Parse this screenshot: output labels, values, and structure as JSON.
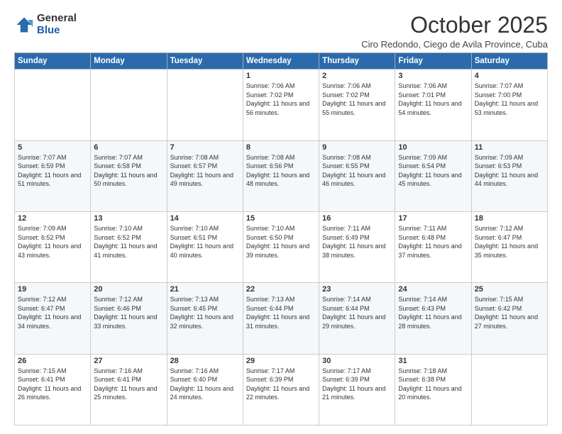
{
  "header": {
    "logo_general": "General",
    "logo_blue": "Blue",
    "month_title": "October 2025",
    "subtitle": "Ciro Redondo, Ciego de Avila Province, Cuba"
  },
  "days_of_week": [
    "Sunday",
    "Monday",
    "Tuesday",
    "Wednesday",
    "Thursday",
    "Friday",
    "Saturday"
  ],
  "weeks": [
    [
      {
        "day": "",
        "info": ""
      },
      {
        "day": "",
        "info": ""
      },
      {
        "day": "",
        "info": ""
      },
      {
        "day": "1",
        "info": "Sunrise: 7:06 AM\nSunset: 7:02 PM\nDaylight: 11 hours and 56 minutes."
      },
      {
        "day": "2",
        "info": "Sunrise: 7:06 AM\nSunset: 7:02 PM\nDaylight: 11 hours and 55 minutes."
      },
      {
        "day": "3",
        "info": "Sunrise: 7:06 AM\nSunset: 7:01 PM\nDaylight: 11 hours and 54 minutes."
      },
      {
        "day": "4",
        "info": "Sunrise: 7:07 AM\nSunset: 7:00 PM\nDaylight: 11 hours and 53 minutes."
      }
    ],
    [
      {
        "day": "5",
        "info": "Sunrise: 7:07 AM\nSunset: 6:59 PM\nDaylight: 11 hours and 51 minutes."
      },
      {
        "day": "6",
        "info": "Sunrise: 7:07 AM\nSunset: 6:58 PM\nDaylight: 11 hours and 50 minutes."
      },
      {
        "day": "7",
        "info": "Sunrise: 7:08 AM\nSunset: 6:57 PM\nDaylight: 11 hours and 49 minutes."
      },
      {
        "day": "8",
        "info": "Sunrise: 7:08 AM\nSunset: 6:56 PM\nDaylight: 11 hours and 48 minutes."
      },
      {
        "day": "9",
        "info": "Sunrise: 7:08 AM\nSunset: 6:55 PM\nDaylight: 11 hours and 46 minutes."
      },
      {
        "day": "10",
        "info": "Sunrise: 7:09 AM\nSunset: 6:54 PM\nDaylight: 11 hours and 45 minutes."
      },
      {
        "day": "11",
        "info": "Sunrise: 7:09 AM\nSunset: 6:53 PM\nDaylight: 11 hours and 44 minutes."
      }
    ],
    [
      {
        "day": "12",
        "info": "Sunrise: 7:09 AM\nSunset: 6:52 PM\nDaylight: 11 hours and 43 minutes."
      },
      {
        "day": "13",
        "info": "Sunrise: 7:10 AM\nSunset: 6:52 PM\nDaylight: 11 hours and 41 minutes."
      },
      {
        "day": "14",
        "info": "Sunrise: 7:10 AM\nSunset: 6:51 PM\nDaylight: 11 hours and 40 minutes."
      },
      {
        "day": "15",
        "info": "Sunrise: 7:10 AM\nSunset: 6:50 PM\nDaylight: 11 hours and 39 minutes."
      },
      {
        "day": "16",
        "info": "Sunrise: 7:11 AM\nSunset: 6:49 PM\nDaylight: 11 hours and 38 minutes."
      },
      {
        "day": "17",
        "info": "Sunrise: 7:11 AM\nSunset: 6:48 PM\nDaylight: 11 hours and 37 minutes."
      },
      {
        "day": "18",
        "info": "Sunrise: 7:12 AM\nSunset: 6:47 PM\nDaylight: 11 hours and 35 minutes."
      }
    ],
    [
      {
        "day": "19",
        "info": "Sunrise: 7:12 AM\nSunset: 6:47 PM\nDaylight: 11 hours and 34 minutes."
      },
      {
        "day": "20",
        "info": "Sunrise: 7:12 AM\nSunset: 6:46 PM\nDaylight: 11 hours and 33 minutes."
      },
      {
        "day": "21",
        "info": "Sunrise: 7:13 AM\nSunset: 6:45 PM\nDaylight: 11 hours and 32 minutes."
      },
      {
        "day": "22",
        "info": "Sunrise: 7:13 AM\nSunset: 6:44 PM\nDaylight: 11 hours and 31 minutes."
      },
      {
        "day": "23",
        "info": "Sunrise: 7:14 AM\nSunset: 6:44 PM\nDaylight: 11 hours and 29 minutes."
      },
      {
        "day": "24",
        "info": "Sunrise: 7:14 AM\nSunset: 6:43 PM\nDaylight: 11 hours and 28 minutes."
      },
      {
        "day": "25",
        "info": "Sunrise: 7:15 AM\nSunset: 6:42 PM\nDaylight: 11 hours and 27 minutes."
      }
    ],
    [
      {
        "day": "26",
        "info": "Sunrise: 7:15 AM\nSunset: 6:41 PM\nDaylight: 11 hours and 26 minutes."
      },
      {
        "day": "27",
        "info": "Sunrise: 7:16 AM\nSunset: 6:41 PM\nDaylight: 11 hours and 25 minutes."
      },
      {
        "day": "28",
        "info": "Sunrise: 7:16 AM\nSunset: 6:40 PM\nDaylight: 11 hours and 24 minutes."
      },
      {
        "day": "29",
        "info": "Sunrise: 7:17 AM\nSunset: 6:39 PM\nDaylight: 11 hours and 22 minutes."
      },
      {
        "day": "30",
        "info": "Sunrise: 7:17 AM\nSunset: 6:39 PM\nDaylight: 11 hours and 21 minutes."
      },
      {
        "day": "31",
        "info": "Sunrise: 7:18 AM\nSunset: 6:38 PM\nDaylight: 11 hours and 20 minutes."
      },
      {
        "day": "",
        "info": ""
      }
    ]
  ]
}
